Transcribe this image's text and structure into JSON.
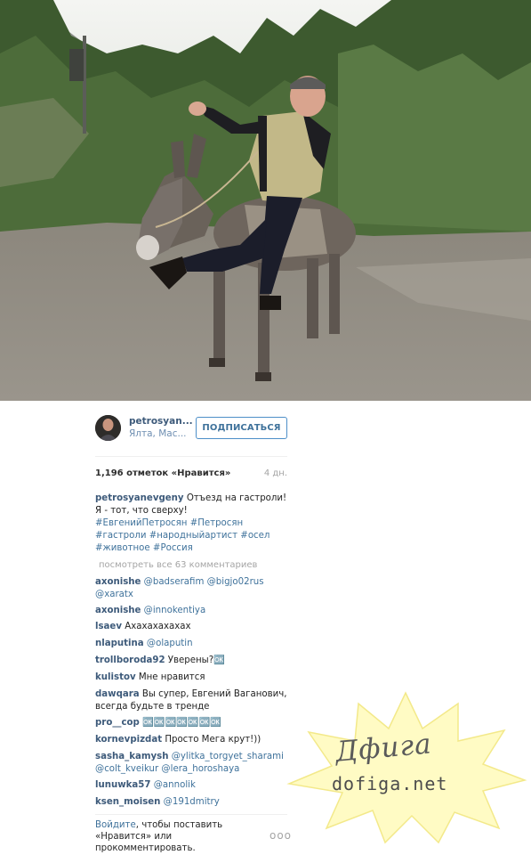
{
  "post": {
    "username": "petrosyan...",
    "location": "Ялта, Мас...",
    "follow_label": "ПОДПИСАТЬСЯ",
    "likes": "1,196 отметок «Нравится»",
    "age": "4 дн.",
    "caption": {
      "user": "petrosyanevgeny",
      "text_line1": " Отъезд на гастроли!",
      "text_line2": "Я - тот, что сверху!",
      "tags_line1": "#ЕвгенийПетросян #Петросян",
      "tags_line2": "#гастроли #народныйартист #осел",
      "tags_line3": "#животное #Россия"
    },
    "view_all": "посмотреть все 63 комментариев",
    "comments": [
      {
        "user": "axonishe",
        "text": " @badserafim @bigjo02rus",
        "text2": "@xaratx"
      },
      {
        "user": "axonishe",
        "text": " @innokentiya"
      },
      {
        "user": "lsaev",
        "text": " Ахахахахахах"
      },
      {
        "user": "nlaputina",
        "text": " @olaputin"
      },
      {
        "user": "trollboroda92",
        "text": " Уверены?🆗"
      },
      {
        "user": "kulistov",
        "text": " Мне нравится"
      },
      {
        "user": "dawqara",
        "text": " Вы супер, Евгений Ваганович,",
        "text2": "всегда будьте в тренде"
      },
      {
        "user": "pro__cop",
        "text": " 🆗🆗🆗🆗🆗🆗🆗"
      },
      {
        "user": "kornevpizdat",
        "text": " Просто Мега крут!))"
      },
      {
        "user": "sasha_kamysh",
        "text": " @ylitka_torgyet_sharami",
        "text2": "@colt_kveikur @lera_horoshaya"
      },
      {
        "user": "lunuwka57",
        "text": " @annolik"
      },
      {
        "user": "ksen_moisen",
        "text": " @191dmitry"
      }
    ],
    "footer": {
      "login_link": "Войдите",
      "login_rest1": ", чтобы поставить",
      "login_line2": "«Нравится» или",
      "login_line3": "прокомментировать."
    },
    "more_icon": "ooo"
  },
  "watermark": {
    "line1": "Дфига",
    "line2": "dofiga.net"
  },
  "colors": {
    "link": "#3f729b",
    "username": "#3d5a7a",
    "muted": "#a5a5a5",
    "watermark_star": "#fffbc4"
  }
}
